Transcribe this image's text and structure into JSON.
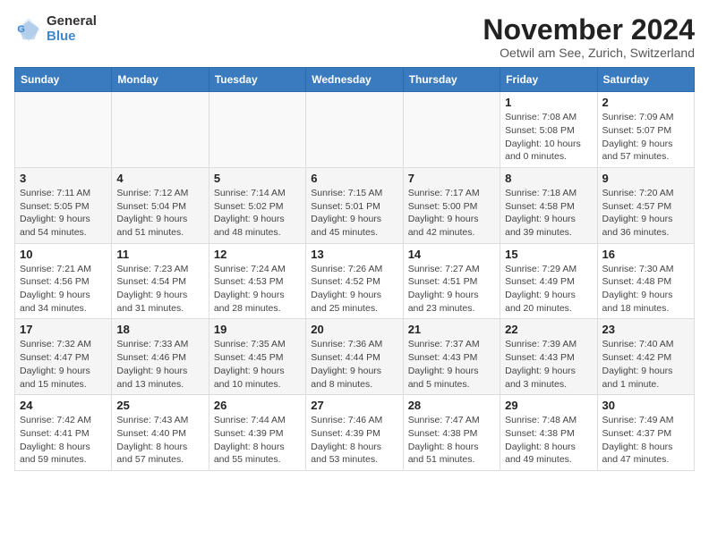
{
  "logo": {
    "general": "General",
    "blue": "Blue"
  },
  "title": "November 2024",
  "location": "Oetwil am See, Zurich, Switzerland",
  "days_of_week": [
    "Sunday",
    "Monday",
    "Tuesday",
    "Wednesday",
    "Thursday",
    "Friday",
    "Saturday"
  ],
  "weeks": [
    [
      {
        "day": "",
        "info": ""
      },
      {
        "day": "",
        "info": ""
      },
      {
        "day": "",
        "info": ""
      },
      {
        "day": "",
        "info": ""
      },
      {
        "day": "",
        "info": ""
      },
      {
        "day": "1",
        "info": "Sunrise: 7:08 AM\nSunset: 5:08 PM\nDaylight: 10 hours\nand 0 minutes."
      },
      {
        "day": "2",
        "info": "Sunrise: 7:09 AM\nSunset: 5:07 PM\nDaylight: 9 hours\nand 57 minutes."
      }
    ],
    [
      {
        "day": "3",
        "info": "Sunrise: 7:11 AM\nSunset: 5:05 PM\nDaylight: 9 hours\nand 54 minutes."
      },
      {
        "day": "4",
        "info": "Sunrise: 7:12 AM\nSunset: 5:04 PM\nDaylight: 9 hours\nand 51 minutes."
      },
      {
        "day": "5",
        "info": "Sunrise: 7:14 AM\nSunset: 5:02 PM\nDaylight: 9 hours\nand 48 minutes."
      },
      {
        "day": "6",
        "info": "Sunrise: 7:15 AM\nSunset: 5:01 PM\nDaylight: 9 hours\nand 45 minutes."
      },
      {
        "day": "7",
        "info": "Sunrise: 7:17 AM\nSunset: 5:00 PM\nDaylight: 9 hours\nand 42 minutes."
      },
      {
        "day": "8",
        "info": "Sunrise: 7:18 AM\nSunset: 4:58 PM\nDaylight: 9 hours\nand 39 minutes."
      },
      {
        "day": "9",
        "info": "Sunrise: 7:20 AM\nSunset: 4:57 PM\nDaylight: 9 hours\nand 36 minutes."
      }
    ],
    [
      {
        "day": "10",
        "info": "Sunrise: 7:21 AM\nSunset: 4:56 PM\nDaylight: 9 hours\nand 34 minutes."
      },
      {
        "day": "11",
        "info": "Sunrise: 7:23 AM\nSunset: 4:54 PM\nDaylight: 9 hours\nand 31 minutes."
      },
      {
        "day": "12",
        "info": "Sunrise: 7:24 AM\nSunset: 4:53 PM\nDaylight: 9 hours\nand 28 minutes."
      },
      {
        "day": "13",
        "info": "Sunrise: 7:26 AM\nSunset: 4:52 PM\nDaylight: 9 hours\nand 25 minutes."
      },
      {
        "day": "14",
        "info": "Sunrise: 7:27 AM\nSunset: 4:51 PM\nDaylight: 9 hours\nand 23 minutes."
      },
      {
        "day": "15",
        "info": "Sunrise: 7:29 AM\nSunset: 4:49 PM\nDaylight: 9 hours\nand 20 minutes."
      },
      {
        "day": "16",
        "info": "Sunrise: 7:30 AM\nSunset: 4:48 PM\nDaylight: 9 hours\nand 18 minutes."
      }
    ],
    [
      {
        "day": "17",
        "info": "Sunrise: 7:32 AM\nSunset: 4:47 PM\nDaylight: 9 hours\nand 15 minutes."
      },
      {
        "day": "18",
        "info": "Sunrise: 7:33 AM\nSunset: 4:46 PM\nDaylight: 9 hours\nand 13 minutes."
      },
      {
        "day": "19",
        "info": "Sunrise: 7:35 AM\nSunset: 4:45 PM\nDaylight: 9 hours\nand 10 minutes."
      },
      {
        "day": "20",
        "info": "Sunrise: 7:36 AM\nSunset: 4:44 PM\nDaylight: 9 hours\nand 8 minutes."
      },
      {
        "day": "21",
        "info": "Sunrise: 7:37 AM\nSunset: 4:43 PM\nDaylight: 9 hours\nand 5 minutes."
      },
      {
        "day": "22",
        "info": "Sunrise: 7:39 AM\nSunset: 4:43 PM\nDaylight: 9 hours\nand 3 minutes."
      },
      {
        "day": "23",
        "info": "Sunrise: 7:40 AM\nSunset: 4:42 PM\nDaylight: 9 hours\nand 1 minute."
      }
    ],
    [
      {
        "day": "24",
        "info": "Sunrise: 7:42 AM\nSunset: 4:41 PM\nDaylight: 8 hours\nand 59 minutes."
      },
      {
        "day": "25",
        "info": "Sunrise: 7:43 AM\nSunset: 4:40 PM\nDaylight: 8 hours\nand 57 minutes."
      },
      {
        "day": "26",
        "info": "Sunrise: 7:44 AM\nSunset: 4:39 PM\nDaylight: 8 hours\nand 55 minutes."
      },
      {
        "day": "27",
        "info": "Sunrise: 7:46 AM\nSunset: 4:39 PM\nDaylight: 8 hours\nand 53 minutes."
      },
      {
        "day": "28",
        "info": "Sunrise: 7:47 AM\nSunset: 4:38 PM\nDaylight: 8 hours\nand 51 minutes."
      },
      {
        "day": "29",
        "info": "Sunrise: 7:48 AM\nSunset: 4:38 PM\nDaylight: 8 hours\nand 49 minutes."
      },
      {
        "day": "30",
        "info": "Sunrise: 7:49 AM\nSunset: 4:37 PM\nDaylight: 8 hours\nand 47 minutes."
      }
    ]
  ]
}
